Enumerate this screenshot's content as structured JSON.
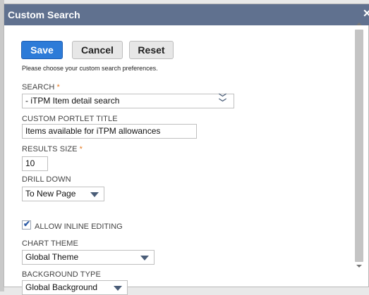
{
  "dialog": {
    "title": "Custom Search",
    "close_glyph": "✕"
  },
  "buttons": {
    "save": "Save",
    "cancel": "Cancel",
    "reset": "Reset"
  },
  "hint": "Please choose your custom search preferences.",
  "search": {
    "label": "SEARCH",
    "required_mark": "*",
    "value": "- iTPM Item detail search",
    "icon": "double-chevron-down-icon"
  },
  "portlet_title": {
    "label": "CUSTOM PORTLET TITLE",
    "value": "Items available for iTPM allowances"
  },
  "results_size": {
    "label": "RESULTS SIZE",
    "required_mark": "*",
    "value": "10"
  },
  "drill_down": {
    "label": "DRILL DOWN",
    "value": "To New Page"
  },
  "inline_editing": {
    "label": "ALLOW INLINE EDITING",
    "checked": true
  },
  "chart_theme": {
    "label": "CHART THEME",
    "value": "Global Theme"
  },
  "background_type": {
    "label": "BACKGROUND TYPE",
    "value": "Global Background"
  },
  "colors": {
    "titlebar": "#60718f",
    "primary_button": "#2d7bd8",
    "required": "#e67a22"
  }
}
